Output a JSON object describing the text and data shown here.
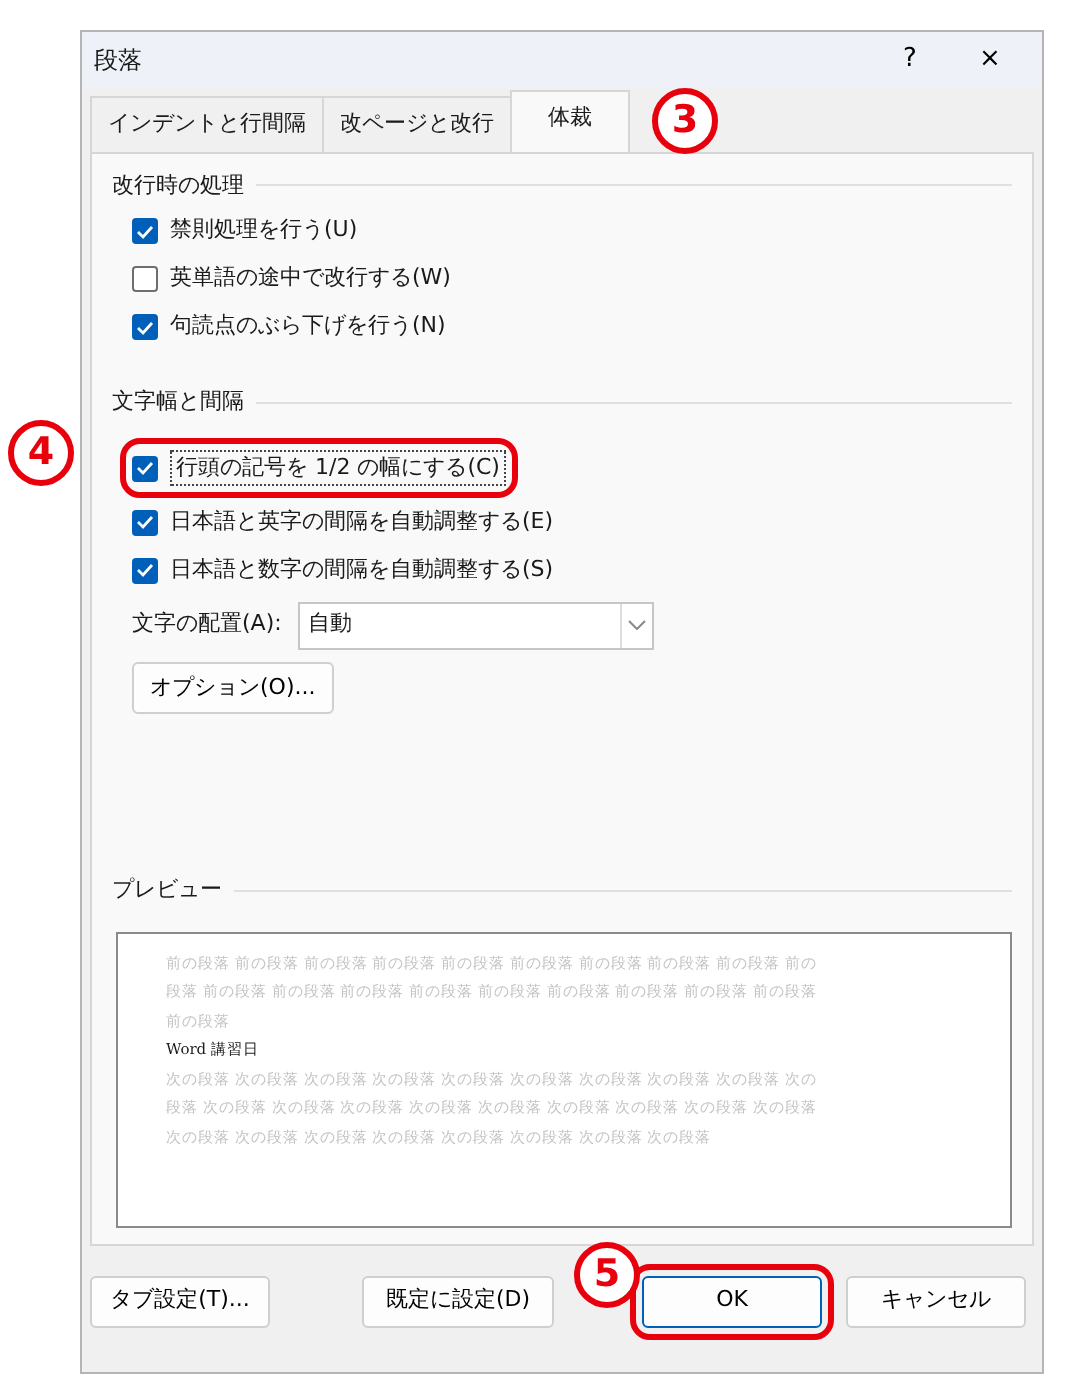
{
  "window": {
    "title": "段落",
    "help": "?",
    "close": "×"
  },
  "tabs": [
    {
      "label": "インデントと行間隔",
      "selected": false
    },
    {
      "label": "改ページと改行",
      "selected": false
    },
    {
      "label": "体裁",
      "selected": true
    }
  ],
  "sections": [
    {
      "title": "改行時の処理",
      "items": [
        {
          "kind": "checkbox",
          "label": "禁則処理を行う(U)",
          "checked": true,
          "highlighted": false
        },
        {
          "kind": "checkbox",
          "label": "英単語の途中で改行する(W)",
          "checked": false,
          "highlighted": false
        },
        {
          "kind": "checkbox",
          "label": "句読点のぶら下げを行う(N)",
          "checked": true,
          "highlighted": false
        }
      ]
    },
    {
      "title": "文字幅と間隔",
      "items": [
        {
          "kind": "checkbox",
          "label": "行頭の記号を 1/2 の幅にする(C)",
          "checked": true,
          "highlighted": true
        },
        {
          "kind": "checkbox",
          "label": "日本語と英字の間隔を自動調整する(E)",
          "checked": true,
          "highlighted": false
        },
        {
          "kind": "checkbox",
          "label": "日本語と数字の間隔を自動調整する(S)",
          "checked": true,
          "highlighted": false
        },
        {
          "kind": "select",
          "label": "文字の配置(A):",
          "value": "自動"
        },
        {
          "kind": "button",
          "label": "オプション(O)..."
        }
      ]
    }
  ],
  "preview": {
    "title": "プレビュー",
    "before_lines": [
      "前の段落 前の段落 前の段落 前の段落 前の段落 前の段落 前の段落 前の段落 前の段落 前の",
      "段落 前の段落 前の段落 前の段落 前の段落 前の段落 前の段落 前の段落 前の段落 前の段落",
      "前の段落"
    ],
    "sample_text": "Word 講習日",
    "after_lines": [
      "次の段落 次の段落 次の段落 次の段落 次の段落 次の段落 次の段落 次の段落 次の段落 次の",
      "段落 次の段落 次の段落 次の段落 次の段落 次の段落 次の段落 次の段落 次の段落 次の段落",
      "次の段落 次の段落 次の段落 次の段落 次の段落 次の段落 次の段落 次の段落"
    ]
  },
  "buttons": [
    {
      "label": "タブ設定(T)...",
      "highlighted": false
    },
    {
      "label": "既定に設定(D)",
      "highlighted": false
    },
    {
      "label": "OK",
      "highlighted": true
    },
    {
      "label": "キャンセル",
      "highlighted": false
    }
  ],
  "step_markers": [
    {
      "label": "3"
    },
    {
      "label": "4"
    },
    {
      "label": "5"
    }
  ]
}
